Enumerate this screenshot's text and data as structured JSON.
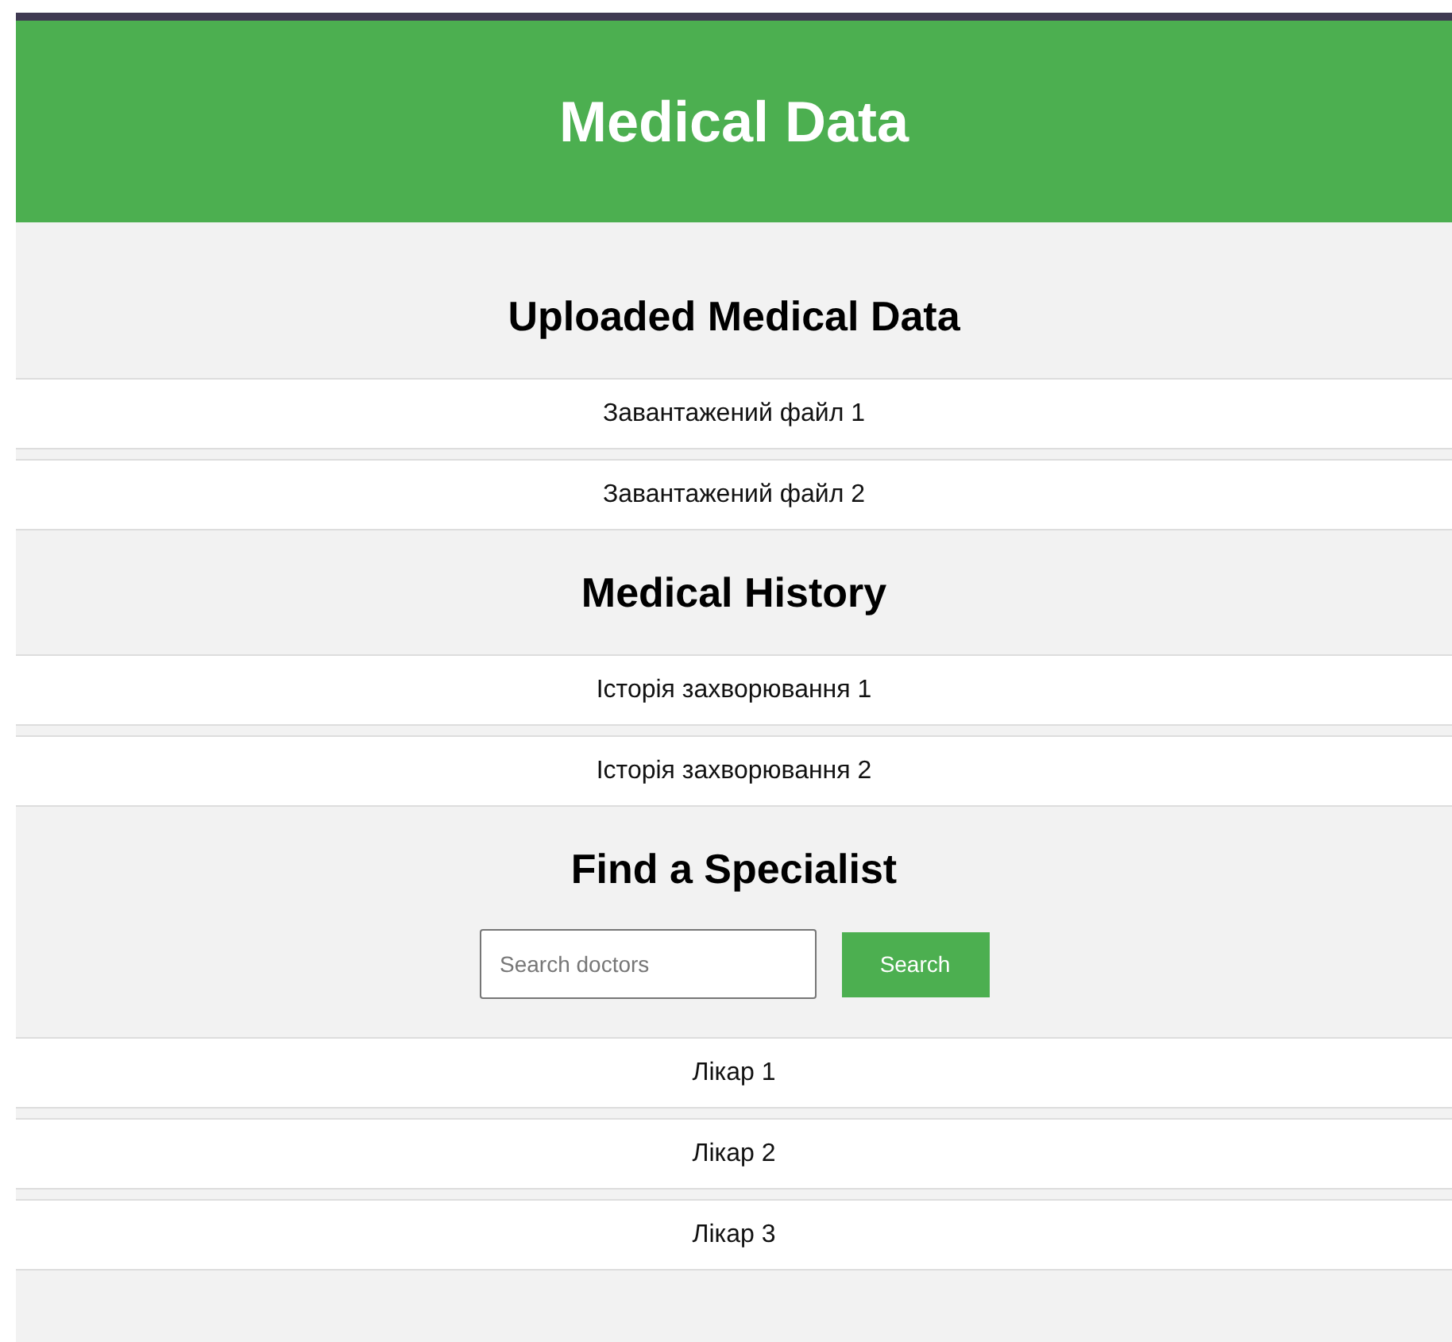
{
  "header": {
    "title": "Medical Data"
  },
  "sections": [
    {
      "kind": "list",
      "heading": "Uploaded Medical Data",
      "items": [
        "Завантажений файл 1",
        "Завантажений файл 2"
      ]
    },
    {
      "kind": "list",
      "heading": "Medical History",
      "items": [
        "Історія захворювання 1",
        "Історія захворювання 2"
      ]
    },
    {
      "kind": "search",
      "heading": "Find a Specialist",
      "search": {
        "placeholder": "Search doctors",
        "button": "Search"
      },
      "items": [
        "Лікар 1",
        "Лікар 2",
        "Лікар 3"
      ]
    }
  ]
}
